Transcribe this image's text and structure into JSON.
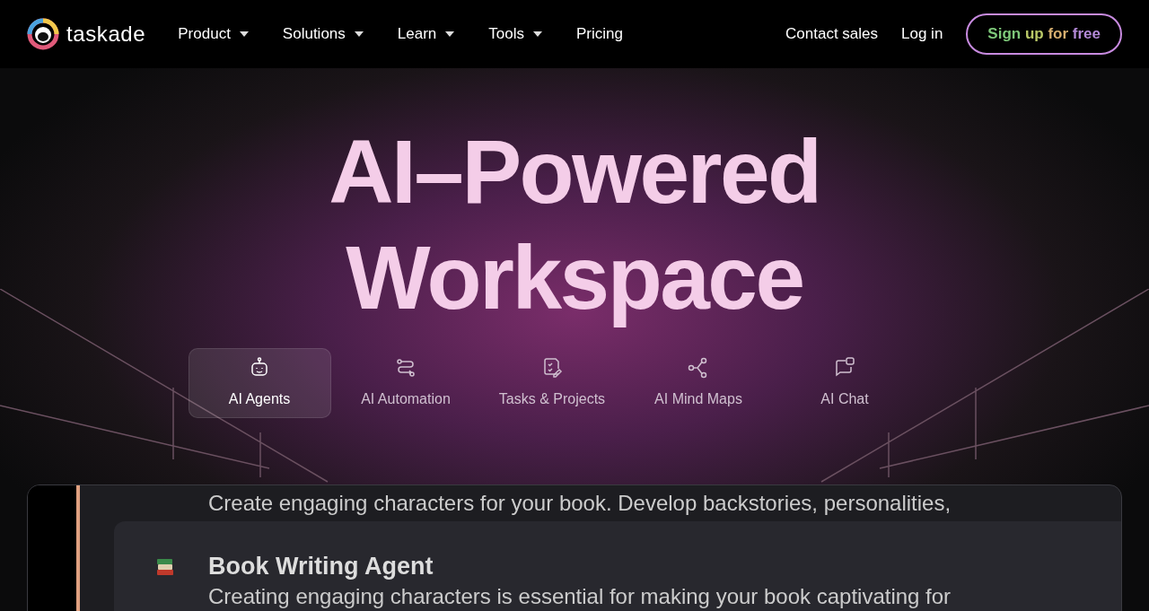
{
  "header": {
    "logo": "taskade",
    "nav": [
      {
        "label": "Product",
        "dropdown": true
      },
      {
        "label": "Solutions",
        "dropdown": true
      },
      {
        "label": "Learn",
        "dropdown": true
      },
      {
        "label": "Tools",
        "dropdown": true
      },
      {
        "label": "Pricing",
        "dropdown": false
      }
    ],
    "links": [
      "Contact sales",
      "Log in"
    ],
    "cta": "Sign up for free"
  },
  "hero": {
    "title_lines": [
      "AI–Powered",
      "Workspace"
    ]
  },
  "tabs": [
    {
      "label": "AI Agents",
      "kind": "robot",
      "selected": true
    },
    {
      "label": "AI Automation",
      "kind": "flow",
      "selected": false
    },
    {
      "label": "Tasks & Projects",
      "kind": "tasks",
      "selected": false
    },
    {
      "label": "AI Mind Maps",
      "kind": "share",
      "selected": false
    },
    {
      "label": "AI Chat",
      "kind": "chat",
      "selected": false
    }
  ],
  "preview": {
    "top_text": "Create engaging characters for your book. Develop backstories, personalities,",
    "card": {
      "title": "Book Writing Agent",
      "text": "Creating engaging characters is essential for making your book captivating for"
    }
  }
}
